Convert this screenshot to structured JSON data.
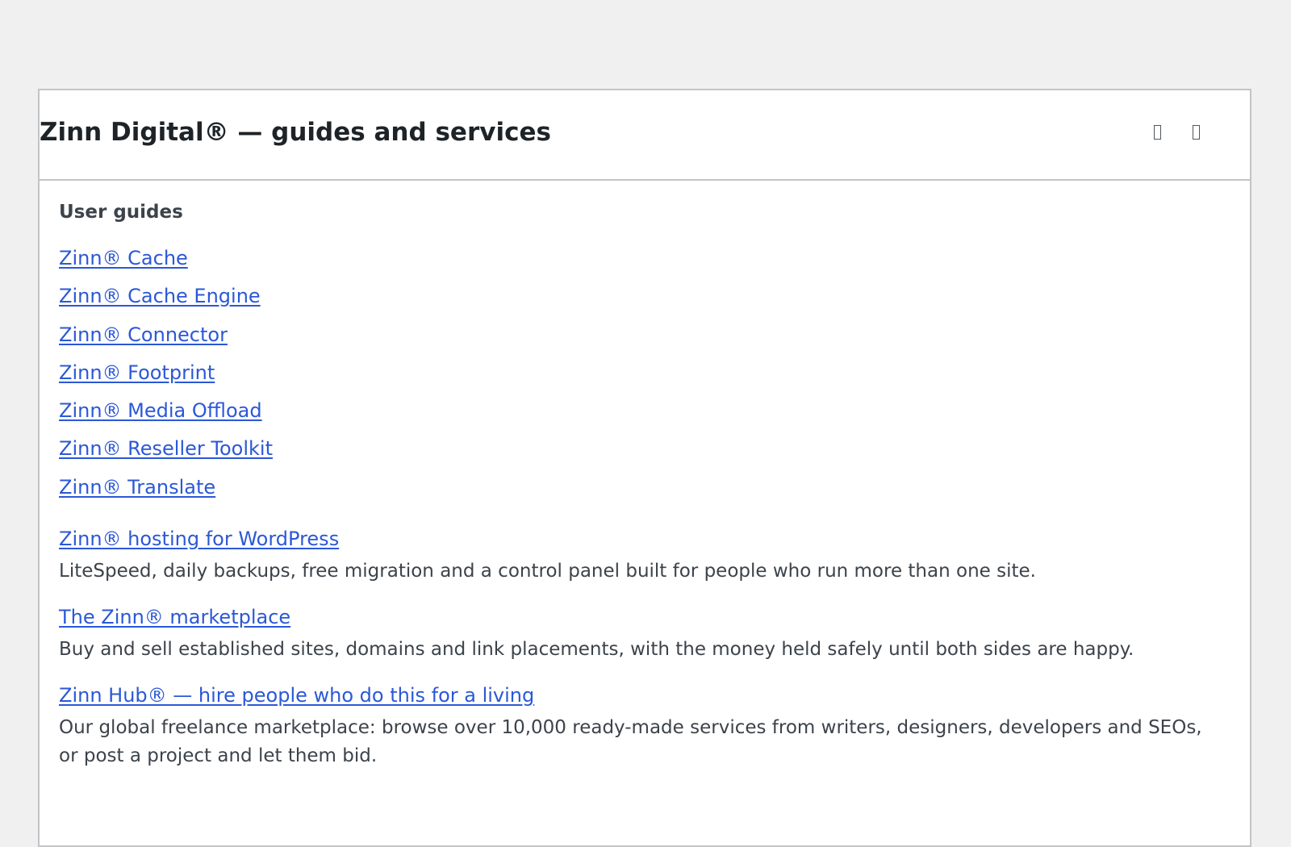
{
  "panel": {
    "title": "Zinn Digital® — guides and services",
    "actions": [
      {
        "icon": "expand-icon"
      },
      {
        "icon": "toggle-icon"
      }
    ]
  },
  "guides": {
    "heading": "User guides",
    "items": [
      {
        "label": "Zinn® Cache"
      },
      {
        "label": "Zinn® Cache Engine"
      },
      {
        "label": "Zinn® Connector"
      },
      {
        "label": "Zinn® Footprint"
      },
      {
        "label": "Zinn® Media Offload"
      },
      {
        "label": "Zinn® Reseller Toolkit"
      },
      {
        "label": "Zinn® Translate"
      }
    ]
  },
  "services": [
    {
      "link": "Zinn® hosting for WordPress",
      "description": "LiteSpeed, daily backups, free migration and a control panel built for people who run more than one site."
    },
    {
      "link": "The Zinn® marketplace",
      "description": "Buy and sell established sites, domains and link placements, with the money held safely until both sides are happy."
    },
    {
      "link": "Zinn Hub® — hire people who do this for a living",
      "description": "Our global freelance marketplace: browse over 10,000 ready-made services from writers, designers, developers and SEOs, or post a project and let them bid."
    }
  ],
  "colors": {
    "link": "#2b58d6",
    "page_bg": "#f0f0f1",
    "panel_border": "#c3c4c7"
  }
}
